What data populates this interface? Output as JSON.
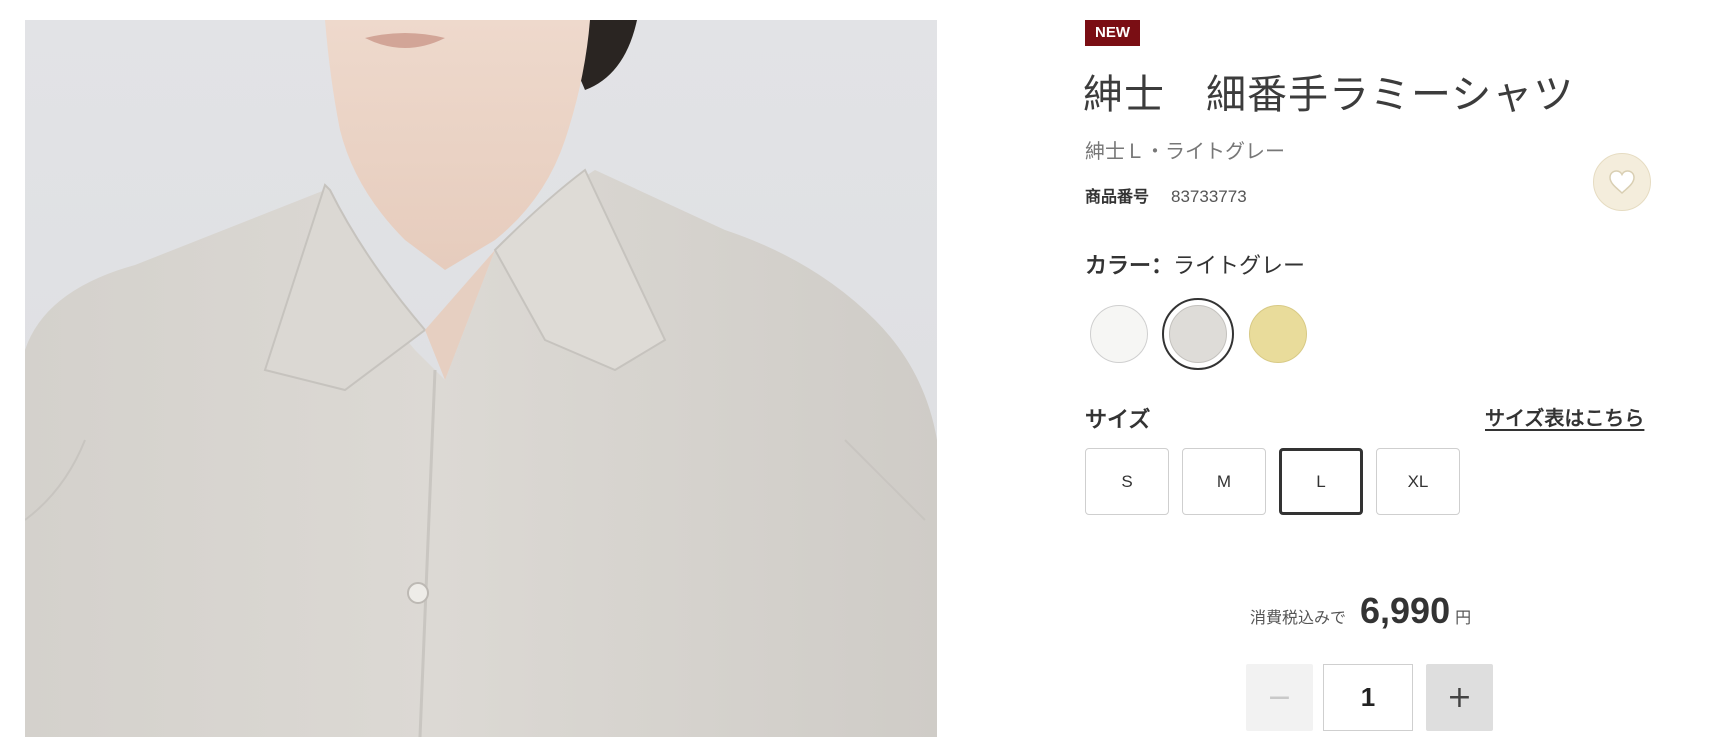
{
  "product": {
    "badge": "NEW",
    "title": "紳士　細番手ラミーシャツ",
    "subtitle": "紳士Ｌ・ライトグレー",
    "number_label": "商品番号",
    "number_value": "83733773"
  },
  "favorite": {
    "icon": "heart-icon"
  },
  "color": {
    "label": "カラー：",
    "selected": "ライトグレー",
    "swatches": [
      {
        "color": "#f6f6f4"
      },
      {
        "color": "#dedcd8",
        "selected": true
      },
      {
        "color": "#e9dc9b"
      }
    ]
  },
  "size": {
    "label": "サイズ",
    "chart_link": "サイズ表はこちら",
    "options": [
      "S",
      "M",
      "L",
      "XL"
    ],
    "selected": "L"
  },
  "price": {
    "prefix": "消費税込みで",
    "value": "6,990",
    "unit": "円"
  },
  "quantity": {
    "minus": "−",
    "value": "1",
    "plus": "+"
  },
  "colors": {
    "badge": "#7a0e14",
    "favorite_bg": "#f4eddc"
  }
}
